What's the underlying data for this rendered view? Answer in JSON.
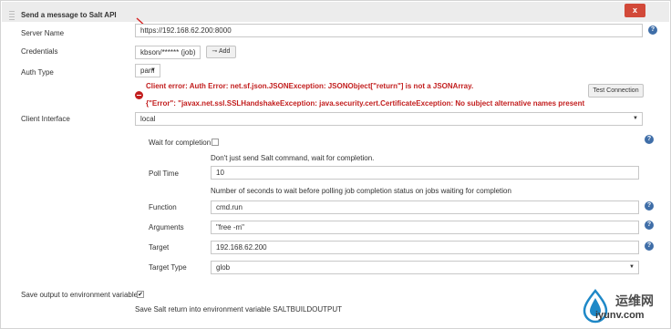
{
  "section": {
    "title": "Send a message to Salt API",
    "close_label": "x"
  },
  "fields": {
    "server_name": {
      "label": "Server Name",
      "value": "https://192.168.62.200:8000"
    },
    "credentials": {
      "label": "Credentials",
      "value": "kbson/****** (job)",
      "add_label": "Add"
    },
    "auth_type": {
      "label": "Auth Type",
      "value": "pam"
    },
    "client_interface": {
      "label": "Client Interface",
      "value": "local"
    },
    "wait_for_completion": {
      "label": "Wait for completion",
      "checked": false,
      "description": "Don't just send Salt command, wait for completion."
    },
    "poll_time": {
      "label": "Poll Time",
      "value": "10",
      "description": "Number of seconds to wait before polling job completion status on jobs waiting for completion"
    },
    "function": {
      "label": "Function",
      "value": "cmd.run"
    },
    "arguments": {
      "label": "Arguments",
      "value": "\"free -m\""
    },
    "target": {
      "label": "Target",
      "value": "192.168.62.200"
    },
    "target_type": {
      "label": "Target Type",
      "value": "glob"
    },
    "save_output": {
      "label": "Save output to environment variable",
      "checked": true,
      "description": "Save Salt return into environment variable SALTBUILDOUTPUT"
    }
  },
  "errors": {
    "line1": "Client error: Auth Error: net.sf.json.JSONException: JSONObject[\"return\"] is not a JSONArray.",
    "line2": "{\"Error\": \"javax.net.ssl.SSLHandshakeException: java.security.cert.CertificateException: No subject alternative names present"
  },
  "buttons": {
    "test_connection": "Test Connection"
  },
  "help_glyph": "?",
  "icons": {
    "help": "help-icon",
    "error": "error-icon",
    "add": "key-icon",
    "caret": "chevron-down-icon"
  },
  "colors": {
    "error": "#c21e1e",
    "close_button": "#d24939",
    "help": "#3f6ea8"
  },
  "watermark": {
    "cn": "运维网",
    "en": "iyunv.com"
  }
}
